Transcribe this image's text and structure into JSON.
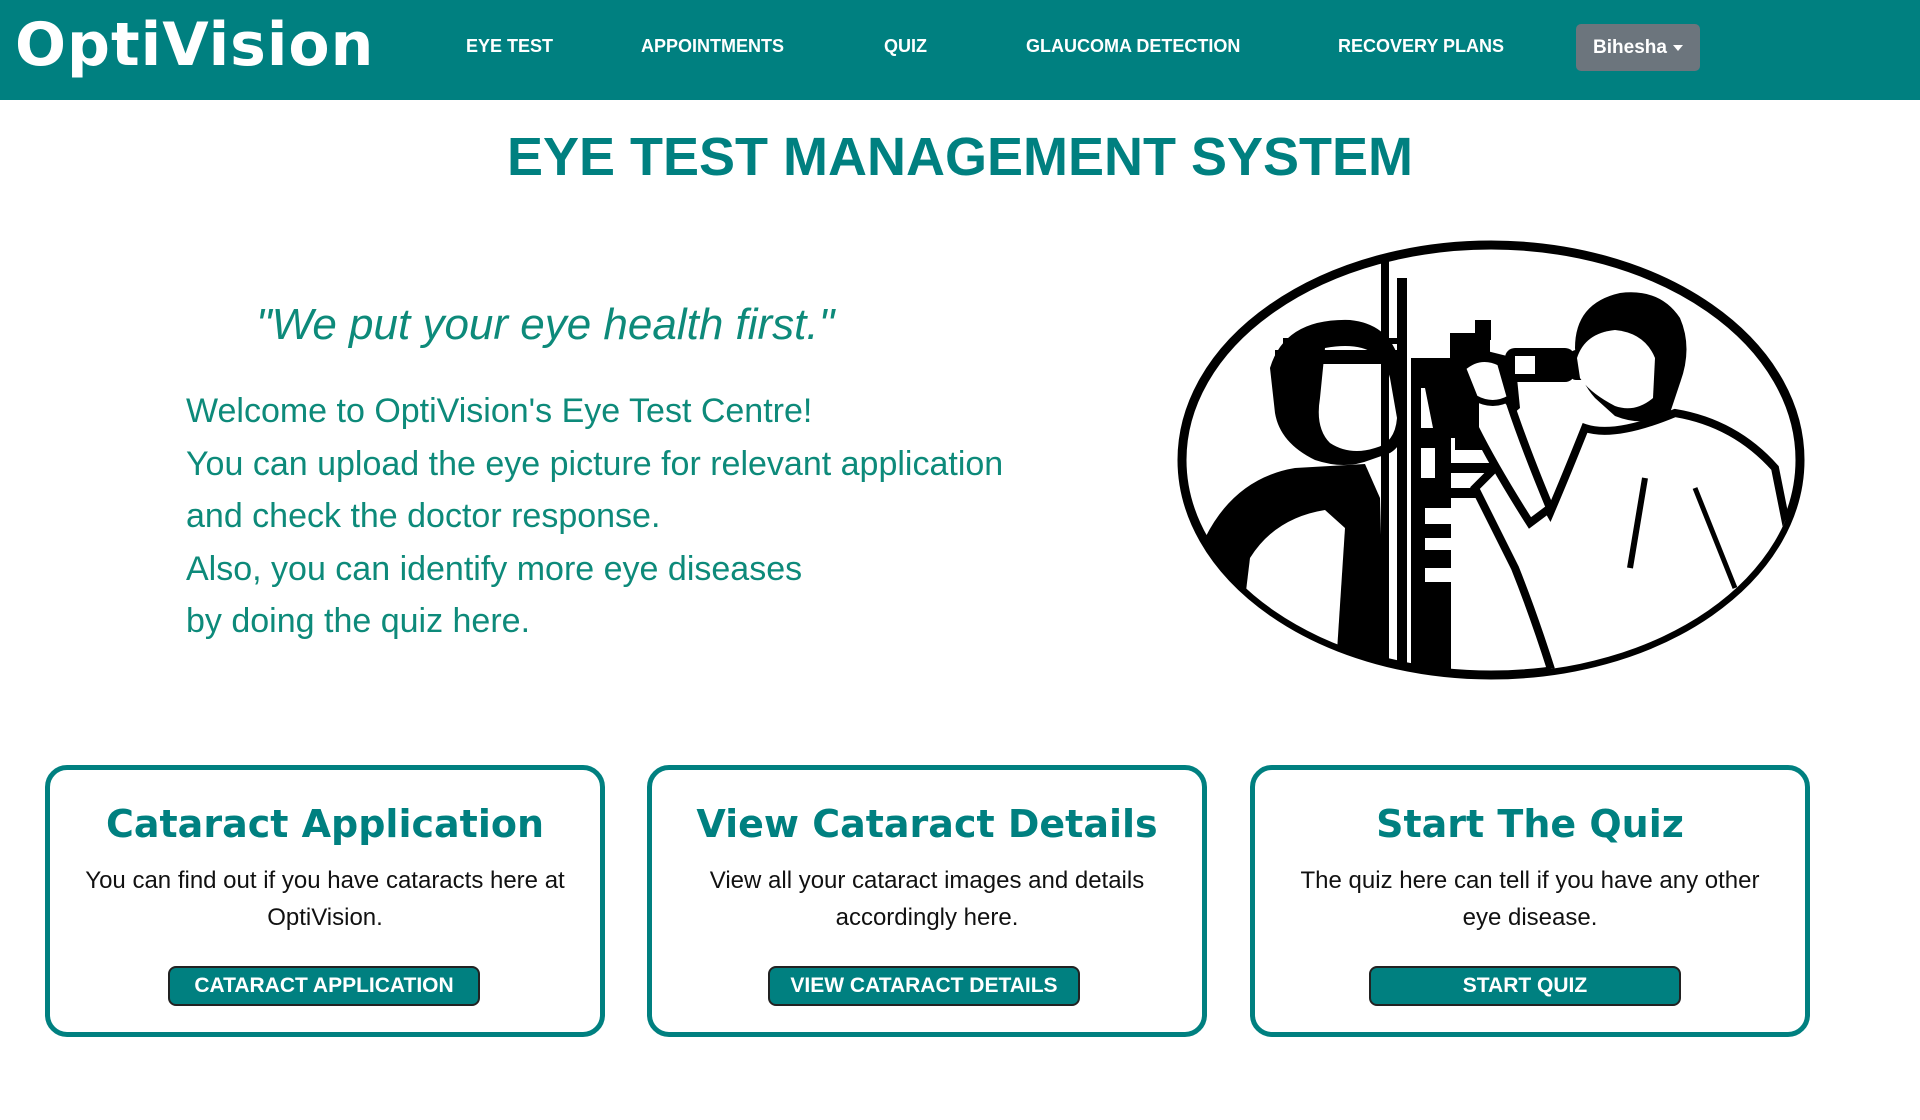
{
  "brand": "OptiVision",
  "nav": {
    "items": [
      "EYE TEST",
      "APPOINTMENTS",
      "QUIZ",
      "GLAUCOMA DETECTION",
      "RECOVERY PLANS"
    ],
    "user": "Bihesha"
  },
  "page_title": "EYE  TEST MANAGEMENT SYSTEM",
  "tagline": "\"We put your eye health first.\"",
  "welcome_lines": [
    "Welcome to OptiVision's Eye Test Centre!",
    "You can upload the eye picture for relevant application",
    "and check the doctor response.",
    "Also, you can identify more eye diseases",
    "by doing the quiz here."
  ],
  "cards": [
    {
      "title": "Cataract Application",
      "text": "You can find out if you have cataracts here at OptiVision.",
      "button": "CATARACT APPLICATION"
    },
    {
      "title": "View Cataract Details",
      "text": "View all your cataract images and details accordingly here.",
      "button": "VIEW CATARACT DETAILS"
    },
    {
      "title": "Start The Quiz",
      "text": "The quiz here can tell if you have any other eye disease.",
      "button": "START QUIZ"
    }
  ],
  "colors": {
    "primary": "#008080",
    "text_teal": "#0d8a7a",
    "dropdown_bg": "#6c757d"
  }
}
